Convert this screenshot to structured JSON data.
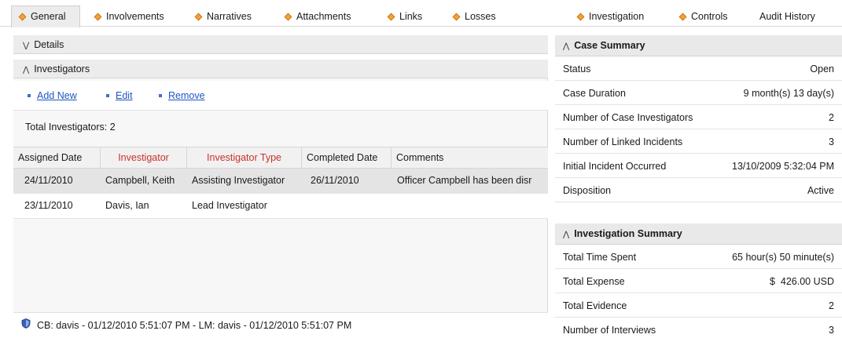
{
  "tabs": [
    {
      "label": "General",
      "icon": "diamond-icon"
    },
    {
      "label": "Involvements",
      "icon": "diamond-icon"
    },
    {
      "label": "Narratives",
      "icon": "diamond-icon"
    },
    {
      "label": "Attachments",
      "icon": "diamond-icon"
    },
    {
      "label": "Links",
      "icon": "diamond-icon"
    },
    {
      "label": "Losses",
      "icon": "diamond-icon"
    },
    {
      "label": "Investigation",
      "icon": "diamond-icon"
    },
    {
      "label": "Controls",
      "icon": "diamond-icon"
    },
    {
      "label": "Audit History"
    }
  ],
  "details": {
    "label": "Details"
  },
  "investigators": {
    "label": "Investigators",
    "actions": {
      "add_new": "Add New",
      "edit": "Edit",
      "remove": "Remove"
    },
    "total": "Total Investigators: 2",
    "columns": [
      "Assigned Date",
      "Investigator",
      "Investigator Type",
      "Completed Date",
      "Comments"
    ],
    "rows": [
      [
        "24/11/2010",
        "Campbell, Keith",
        "Assisting Investigator",
        "26/11/2010",
        "Officer Campbell has been disr"
      ],
      [
        "23/11/2010",
        "Davis, Ian",
        "Lead Investigator",
        "",
        ""
      ]
    ]
  },
  "footer": {
    "text": "CB: davis - 01/12/2010 5:51:07 PM - LM: davis - 01/12/2010 5:51:07 PM"
  },
  "case_summary": {
    "title": "Case Summary",
    "items": [
      {
        "label": "Status",
        "value": "Open"
      },
      {
        "label": "Case Duration",
        "value": "9 month(s) 13 day(s)"
      },
      {
        "label": "Number of Case Investigators",
        "value": "2"
      },
      {
        "label": "Number of Linked Incidents",
        "value": "3"
      },
      {
        "label": "Initial Incident Occurred",
        "value": "13/10/2009 5:32:04 PM"
      },
      {
        "label": "Disposition",
        "value": "Active"
      }
    ]
  },
  "investigation_summary": {
    "title": "Investigation Summary",
    "items": [
      {
        "label": "Total Time Spent",
        "value": "65 hour(s) 50 minute(s)"
      },
      {
        "label": "Total Expense",
        "value": "$  426.00 USD"
      },
      {
        "label": "Total Evidence",
        "value": "2"
      },
      {
        "label": "Number of Interviews",
        "value": "3"
      }
    ]
  },
  "colors": {
    "accent_diamond": "#f2a33a",
    "link": "#1e55c4",
    "required_header": "#c8322b"
  }
}
